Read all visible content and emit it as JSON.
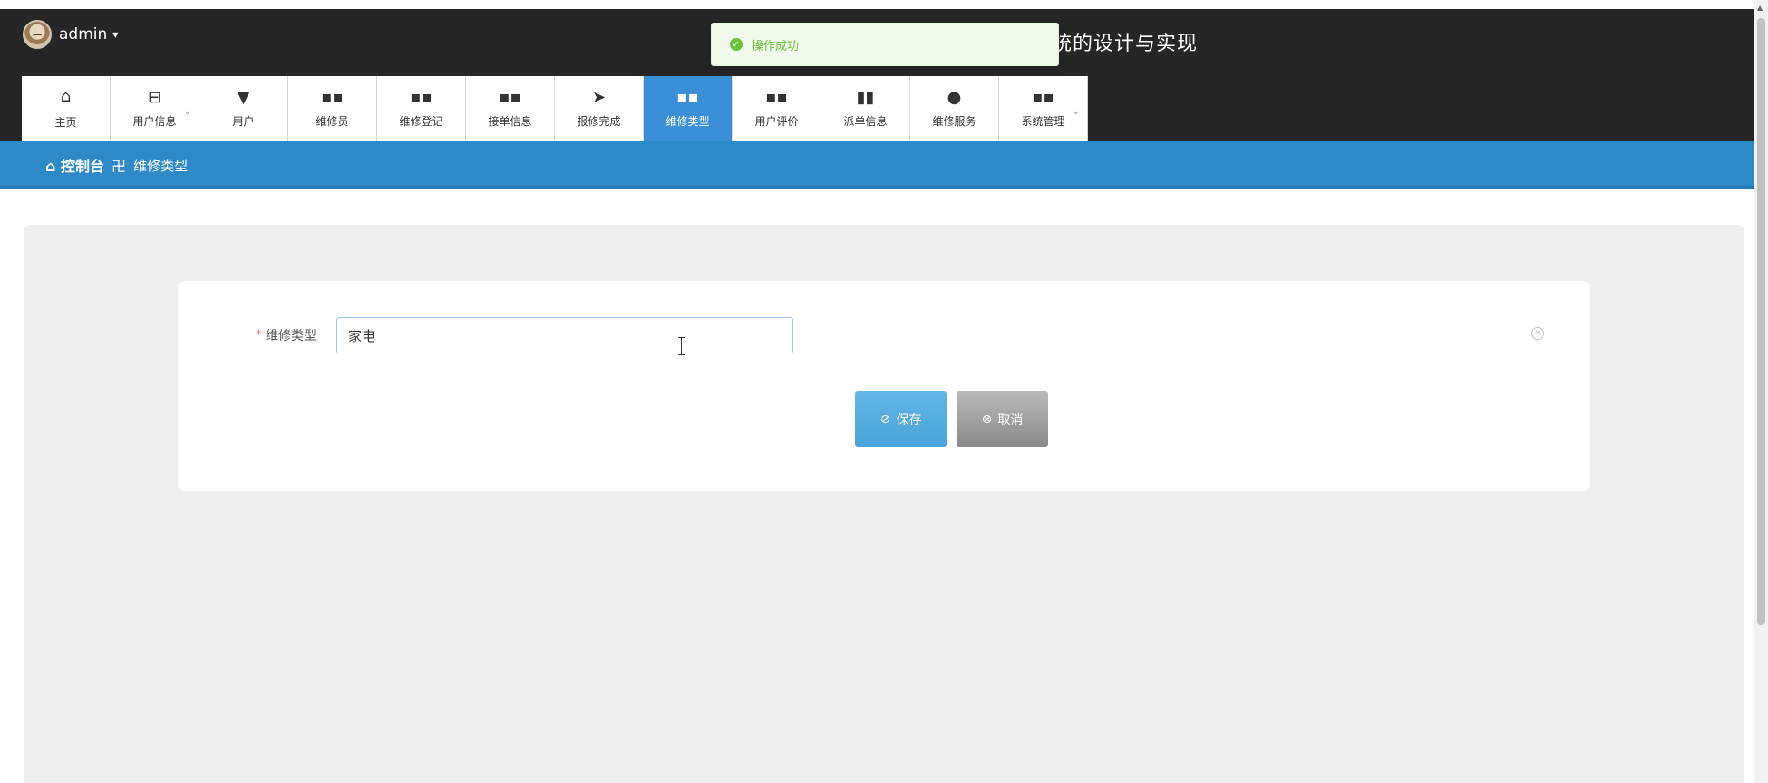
{
  "header": {
    "username": "admin",
    "caret": "▾",
    "title_fragment": "统的设计与实现"
  },
  "toast": {
    "message": "操作成功",
    "color": "#67c23a"
  },
  "nav": {
    "tabs": [
      {
        "icon": "⌂",
        "label": "主页"
      },
      {
        "icon": "⊟",
        "label": "用户信息",
        "has_submenu": true
      },
      {
        "icon": "▼",
        "label": "用户"
      },
      {
        "icon": "▪▪",
        "label": "维修员"
      },
      {
        "icon": "▪▪",
        "label": "维修登记"
      },
      {
        "icon": "▪▪",
        "label": "接单信息"
      },
      {
        "icon": "➤",
        "label": "报修完成"
      },
      {
        "icon": "▪▪",
        "label": "维修类型",
        "active": true
      },
      {
        "icon": "▪▪",
        "label": "用户评价"
      },
      {
        "icon": "▮▮",
        "label": "派单信息"
      },
      {
        "icon": "●",
        "label": "维修服务"
      },
      {
        "icon": "▪▪",
        "label": "系统管理",
        "has_submenu": true
      }
    ],
    "active_color": "#3a8fd6"
  },
  "breadcrumb": {
    "home": "控制台",
    "separator": "卍",
    "current": "维修类型"
  },
  "form": {
    "required_mark": "*",
    "field_label": "维修类型",
    "field_value": "家电",
    "save_label": "保存",
    "cancel_label": "取消"
  }
}
